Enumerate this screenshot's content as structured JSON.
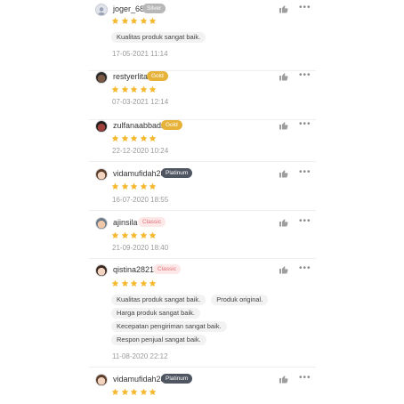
{
  "reviews": [
    {
      "username": "joger_68",
      "badge": "Silver",
      "badge_type": "silver",
      "rating": 5,
      "tags": [
        [
          "Kualitas produk sangat baik."
        ]
      ],
      "date": "17-05-2021 11:14",
      "avatar": "default-person"
    },
    {
      "username": "restyerlita",
      "badge": "Gold",
      "badge_type": "gold",
      "rating": 5,
      "tags": [],
      "date": "07-03-2021 12:14",
      "avatar": "photo"
    },
    {
      "username": "zulfanaabbad2",
      "badge": "Gold",
      "badge_type": "gold",
      "rating": 5,
      "tags": [],
      "date": "22-12-2020 10:24",
      "avatar": "photo"
    },
    {
      "username": "vidamufidah28",
      "badge": "Platinum",
      "badge_type": "platinum",
      "rating": 5,
      "tags": [],
      "date": "16-07-2020 18:55",
      "avatar": "photo"
    },
    {
      "username": "ajinsila",
      "badge": "Classic",
      "badge_type": "classic",
      "rating": 5,
      "tags": [],
      "date": "21-09-2020 18:40",
      "avatar": "photo"
    },
    {
      "username": "qistina2821",
      "badge": "Classic",
      "badge_type": "classic",
      "rating": 5,
      "tags": [
        [
          "Kualitas produk sangat baik.",
          "Produk original."
        ],
        [
          "Harga produk sangat baik."
        ],
        [
          "Kecepatan pengiriman sangat baik."
        ],
        [
          "Respon penjual sangat baik."
        ]
      ],
      "date": "11-08-2020 22:12",
      "avatar": "photo"
    },
    {
      "username": "vidamufidah28",
      "badge": "Platinum",
      "badge_type": "platinum",
      "rating": 5,
      "tags": [],
      "date": "",
      "avatar": "photo"
    }
  ],
  "colors": {
    "star": "#f5b82e",
    "like_icon": "#9e9e9e",
    "more_icon": "#8a8a8a"
  }
}
